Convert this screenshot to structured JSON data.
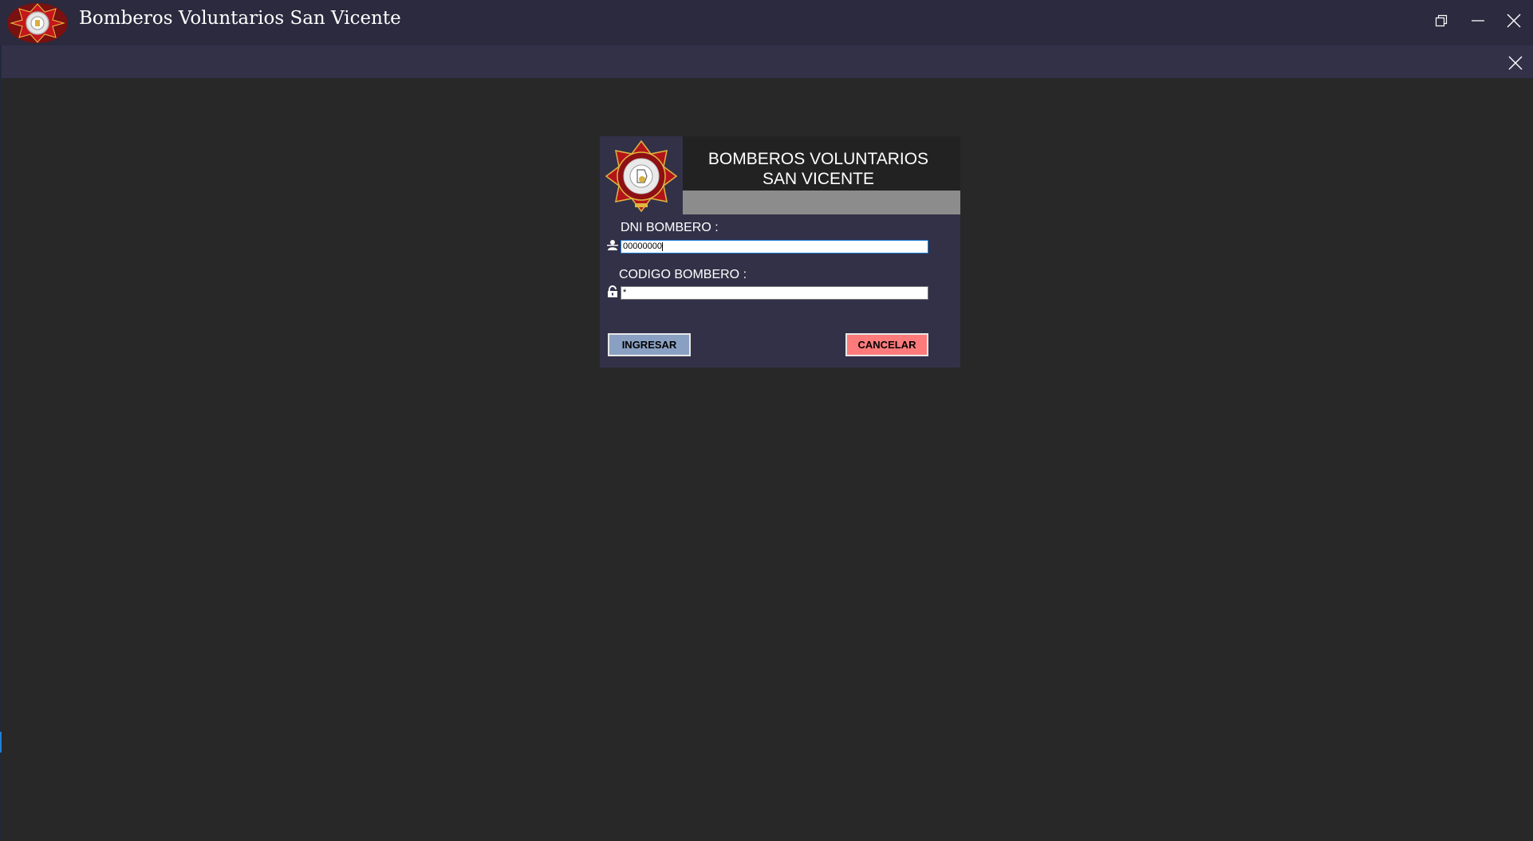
{
  "window": {
    "title": "Bomberos Voluntarios San Vicente",
    "logo_icon": "fire-department-badge-icon",
    "controls": [
      "restore-icon",
      "minimize-icon",
      "close-icon"
    ]
  },
  "subbar": {
    "close_icon": "close-icon"
  },
  "login": {
    "title": "BOMBEROS VOLUNTARIOS\nSAN VICENTE",
    "dni_label": "DNI BOMBERO :",
    "dni_value": "00000000",
    "codigo_label": "CODIGO BOMBERO :",
    "codigo_value": "*",
    "ingresar_label": "INGRESAR",
    "cancelar_label": "CANCELAR",
    "dni_icon": "user-icon",
    "codigo_icon": "lock-icon"
  },
  "colors": {
    "background": "#282828",
    "titlebar": "#2b2a3e",
    "panel": "#333148",
    "ingresar": "#8aa0c2",
    "cancelar": "#ff7b7b"
  }
}
